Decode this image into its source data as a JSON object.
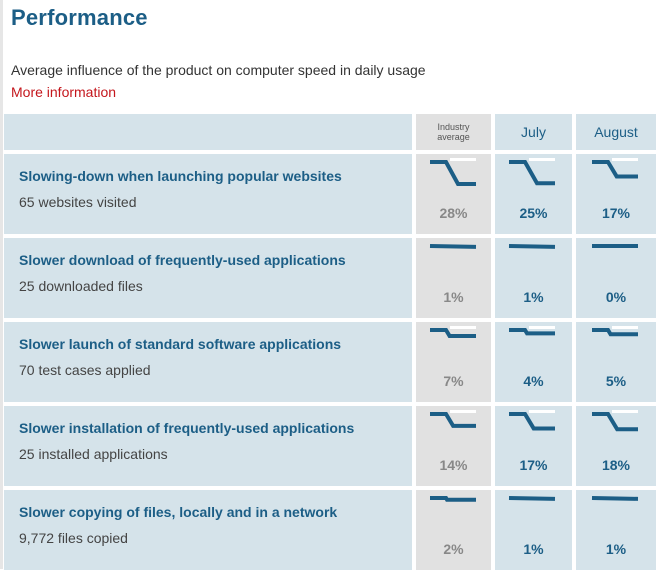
{
  "title": "Performance",
  "subtitle": "Average influence of the product on computer speed in daily usage",
  "more_link": "More information",
  "columns": {
    "industry": "Industry average",
    "m1": "July",
    "m2": "August"
  },
  "colors": {
    "accent": "#1c5e86",
    "link": "#c4161c",
    "cell_bg": "#d5e3ea",
    "industry_bg": "#e1e1e1"
  },
  "rows": [
    {
      "title": "Slowing-down when launching popular websites",
      "sub": "65 websites visited",
      "industry": "28%",
      "m1": "25%",
      "m2": "17%",
      "industry_value": 28,
      "m1_value": 25,
      "m2_value": 17
    },
    {
      "title": "Slower download of frequently-used applications",
      "sub": "25 downloaded files",
      "industry": "1%",
      "m1": "1%",
      "m2": "0%",
      "industry_value": 1,
      "m1_value": 1,
      "m2_value": 0
    },
    {
      "title": "Slower launch of standard software applications",
      "sub": "70 test cases applied",
      "industry": "7%",
      "m1": "4%",
      "m2": "5%",
      "industry_value": 7,
      "m1_value": 4,
      "m2_value": 5
    },
    {
      "title": "Slower installation of frequently-used applications",
      "sub": "25 installed applications",
      "industry": "14%",
      "m1": "17%",
      "m2": "18%",
      "industry_value": 14,
      "m1_value": 17,
      "m2_value": 18
    },
    {
      "title": "Slower copying of files, locally and in a network",
      "sub": "9,772 files copied",
      "industry": "2%",
      "m1": "1%",
      "m2": "1%",
      "industry_value": 2,
      "m1_value": 1,
      "m2_value": 1
    }
  ]
}
